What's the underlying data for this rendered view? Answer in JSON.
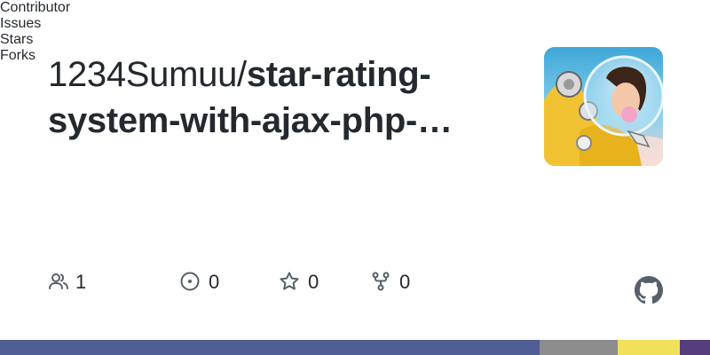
{
  "repo": {
    "owner": "1234Sumuu/",
    "name_line1": "star-rating-",
    "name_line2": "system-with-ajax-php-…"
  },
  "stats": {
    "contributors": {
      "count": "1",
      "label": "Contributor",
      "icon": "people-icon"
    },
    "issues": {
      "count": "0",
      "label": "Issues",
      "icon": "issue-opened-icon"
    },
    "stars": {
      "count": "0",
      "label": "Stars",
      "icon": "star-icon"
    },
    "forks": {
      "count": "0",
      "label": "Forks",
      "icon": "repo-forked-icon"
    }
  },
  "branding": {
    "logo": "github-mark-icon"
  },
  "avatar": {
    "description_icon": "avatar-image"
  },
  "language_bar": [
    {
      "color": "#4f5d95",
      "fraction": 0.76
    },
    {
      "color": "#8c8c8c",
      "fraction": 0.11
    },
    {
      "color": "#f1e05a",
      "fraction": 0.087
    },
    {
      "color": "#563d7c",
      "fraction": 0.043
    }
  ]
}
